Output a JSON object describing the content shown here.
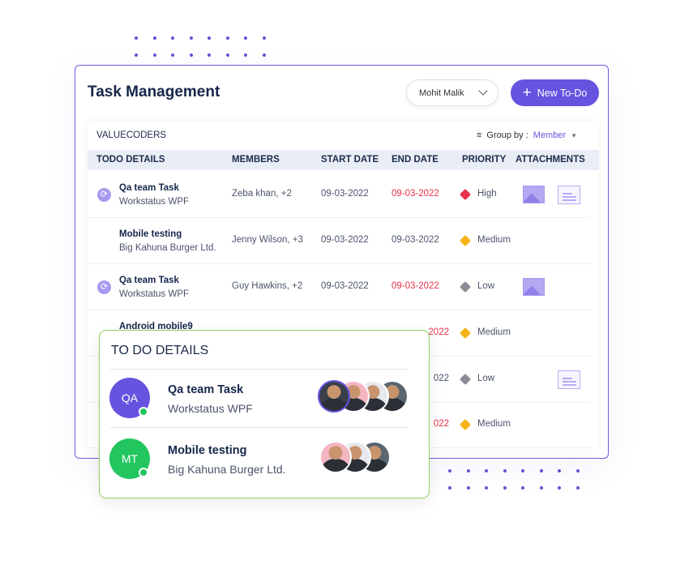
{
  "colors": {
    "accent": "#6653e0",
    "high": "#e8324a",
    "medium": "#f5b415",
    "low": "#8a8d95",
    "overlay_border": "#8ecf6a"
  },
  "header": {
    "title": "Task Management",
    "user_select": "Mohit Malik",
    "new_button": "New To-Do"
  },
  "table": {
    "org": "VALUECODERS",
    "group_by_label": "Group by :",
    "group_by_value": "Member",
    "columns": [
      "TODO DETAILS",
      "MEMBERS",
      "START DATE",
      "END DATE",
      "PRIORITY",
      "ATTACHMENTS"
    ],
    "rows": [
      {
        "name": "Qa team Task",
        "company": "Workstatus WPF",
        "members": "Zeba khan, +2",
        "start": "09-03-2022",
        "end": "09-03-2022",
        "end_overdue": true,
        "priority": "High",
        "attachments": [
          "image",
          "document"
        ],
        "synced": true
      },
      {
        "name": "Mobile testing",
        "company": "Big Kahuna Burger Ltd.",
        "members": "Jenny Wilson, +3",
        "start": "09-03-2022",
        "end": "09-03-2022",
        "end_overdue": false,
        "priority": "Medium",
        "attachments": [],
        "synced": false
      },
      {
        "name": "Qa team Task",
        "company": "Workstatus WPF",
        "members": "Guy Hawkins, +2",
        "start": "09-03-2022",
        "end": "09-03-2022",
        "end_overdue": true,
        "priority": "Low",
        "attachments": [
          "image"
        ],
        "synced": true
      },
      {
        "name": "Android mobile9",
        "company": "",
        "members": "",
        "start": "",
        "end": "2022",
        "end_overdue": true,
        "priority": "Medium",
        "attachments": [],
        "synced": false
      },
      {
        "name": "",
        "company": "",
        "members": "",
        "start": "",
        "end": "022",
        "end_overdue": false,
        "priority": "Low",
        "attachments": [
          "document"
        ],
        "synced": false
      },
      {
        "name": "",
        "company": "",
        "members": "",
        "start": "",
        "end": "022",
        "end_overdue": true,
        "priority": "Medium",
        "attachments": [],
        "synced": false
      }
    ]
  },
  "details": {
    "title": "TO DO DETAILS",
    "items": [
      {
        "initials": "QA",
        "name": "Qa team Task",
        "company": "Workstatus WPF",
        "color": "#6653e0",
        "member_avatars": 4
      },
      {
        "initials": "MT",
        "name": "Mobile testing",
        "company": "Big Kahuna Burger Ltd.",
        "color": "#22c55e",
        "member_avatars": 3
      }
    ]
  }
}
